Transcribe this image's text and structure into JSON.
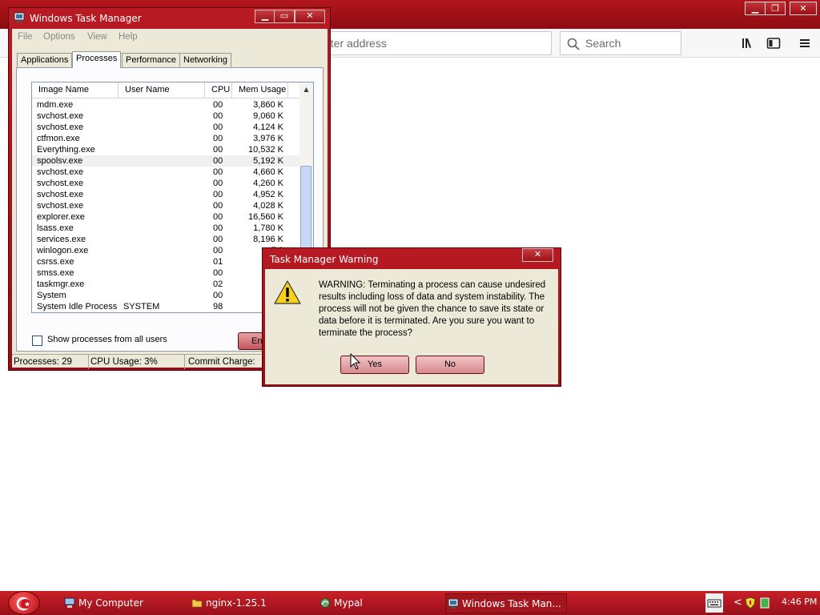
{
  "browser": {
    "url_placeholder": "nter address",
    "search_placeholder": "Search",
    "caption": {
      "minimize": "▁",
      "restore": "❐",
      "close": "✕"
    }
  },
  "taskmgr": {
    "title": "Windows Task Manager",
    "caption": {
      "minimize": "▁",
      "maximize": "▭",
      "close": "✕"
    },
    "menu": [
      "File",
      "Options",
      "View",
      "Help"
    ],
    "tabs": [
      "Applications",
      "Processes",
      "Performance",
      "Networking"
    ],
    "active_tab": "Processes",
    "columns": [
      "Image Name",
      "User Name",
      "CPU",
      "Mem Usage"
    ],
    "rows": [
      {
        "name": "mdm.exe",
        "user": "",
        "cpu": "00",
        "mem": "3,860 K"
      },
      {
        "name": "svchost.exe",
        "user": "",
        "cpu": "00",
        "mem": "9,060 K"
      },
      {
        "name": "svchost.exe",
        "user": "",
        "cpu": "00",
        "mem": "4,124 K"
      },
      {
        "name": "ctfmon.exe",
        "user": "",
        "cpu": "00",
        "mem": "3,976 K"
      },
      {
        "name": "Everything.exe",
        "user": "",
        "cpu": "00",
        "mem": "10,532 K"
      },
      {
        "name": "spoolsv.exe",
        "user": "",
        "cpu": "00",
        "mem": "5,192 K"
      },
      {
        "name": "svchost.exe",
        "user": "",
        "cpu": "00",
        "mem": "4,660 K"
      },
      {
        "name": "svchost.exe",
        "user": "",
        "cpu": "00",
        "mem": "4,260 K"
      },
      {
        "name": "svchost.exe",
        "user": "",
        "cpu": "00",
        "mem": "4,952 K"
      },
      {
        "name": "svchost.exe",
        "user": "",
        "cpu": "00",
        "mem": "4,028 K"
      },
      {
        "name": "explorer.exe",
        "user": "",
        "cpu": "00",
        "mem": "16,560 K"
      },
      {
        "name": "lsass.exe",
        "user": "",
        "cpu": "00",
        "mem": "1,780 K"
      },
      {
        "name": "services.exe",
        "user": "",
        "cpu": "00",
        "mem": "8,196 K"
      },
      {
        "name": "winlogon.exe",
        "user": "",
        "cpu": "00",
        "mem": "7,9"
      },
      {
        "name": "csrss.exe",
        "user": "",
        "cpu": "01",
        "mem": "4,5"
      },
      {
        "name": "smss.exe",
        "user": "",
        "cpu": "00",
        "mem": "4"
      },
      {
        "name": "taskmgr.exe",
        "user": "",
        "cpu": "02",
        "mem": "5,2"
      },
      {
        "name": "System",
        "user": "",
        "cpu": "00",
        "mem": "2"
      },
      {
        "name": "System Idle Process",
        "user": "SYSTEM",
        "cpu": "98",
        "mem": ""
      }
    ],
    "show_all_label": "Show processes from all users",
    "end_button": "End",
    "status": {
      "processes": "Processes: 29",
      "cpu": "CPU Usage: 3%",
      "commit": "Commit Charge:"
    }
  },
  "dialog": {
    "title": "Task Manager Warning",
    "close": "✕",
    "message": "WARNING: Terminating a process can cause undesired results including loss of data and system instability. The process will not be given the chance to save its state or data before it is terminated.  Are you sure you want to terminate the process?",
    "yes": "Yes",
    "no": "No"
  },
  "taskbar": {
    "items": [
      "My Computer",
      "nginx-1.25.1",
      "Mypal",
      "Windows Task Man..."
    ],
    "tray_chevron": "<",
    "clock": "4:46 PM"
  },
  "colors": {
    "accent": "#b2151d",
    "dialog_bg": "#ece9d8"
  }
}
